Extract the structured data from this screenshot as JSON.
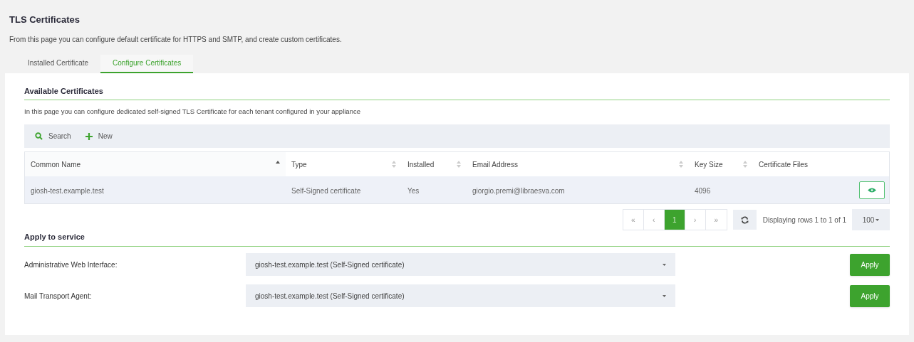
{
  "page": {
    "title": "TLS Certificates",
    "description": "From this page you can configure default certificate for HTTPS and SMTP, and create custom certificates."
  },
  "tabs": [
    {
      "label": "Installed Certificate",
      "selected": false
    },
    {
      "label": "Configure Certificates",
      "selected": true
    }
  ],
  "available": {
    "title": "Available Certificates",
    "description": "In this page you can configure dedicated self-signed TLS Certificate for each tenant configured in your appliance",
    "toolbar": [
      {
        "kind": "search",
        "label": "Search"
      },
      {
        "kind": "new",
        "label": "New"
      }
    ],
    "columns": [
      {
        "label": "Common Name",
        "sortable": true,
        "sorted": true
      },
      {
        "label": "Type",
        "sortable": true,
        "sorted": false
      },
      {
        "label": "Installed",
        "sortable": true,
        "sorted": false
      },
      {
        "label": "Email Address",
        "sortable": true,
        "sorted": false
      },
      {
        "label": "Key Size",
        "sortable": true,
        "sorted": false
      },
      {
        "label": "Certificate Files",
        "sortable": false
      }
    ],
    "rows": [
      {
        "cells": [
          "giosh-test.example.test",
          "Self-Signed certificate",
          "Yes",
          "giorgio.premi@libraesva.com",
          "4096"
        ]
      }
    ],
    "pager": {
      "buttons": [
        {
          "label": "«",
          "selected": false
        },
        {
          "label": "‹",
          "selected": false
        },
        {
          "label": "1",
          "selected": true
        },
        {
          "label": "›",
          "selected": false
        },
        {
          "label": "»",
          "selected": false
        }
      ],
      "info": "Displaying rows 1 to 1 of 1",
      "page_size": "100"
    }
  },
  "apply": {
    "title": "Apply to service",
    "services": [
      {
        "label": "Administrative Web Interface:",
        "value": "giosh-test.example.test (Self-Signed certificate)",
        "button": "Apply"
      },
      {
        "label": "Mail Transport Agent:",
        "value": "giosh-test.example.test (Self-Signed certificate)",
        "button": "Apply"
      }
    ]
  }
}
